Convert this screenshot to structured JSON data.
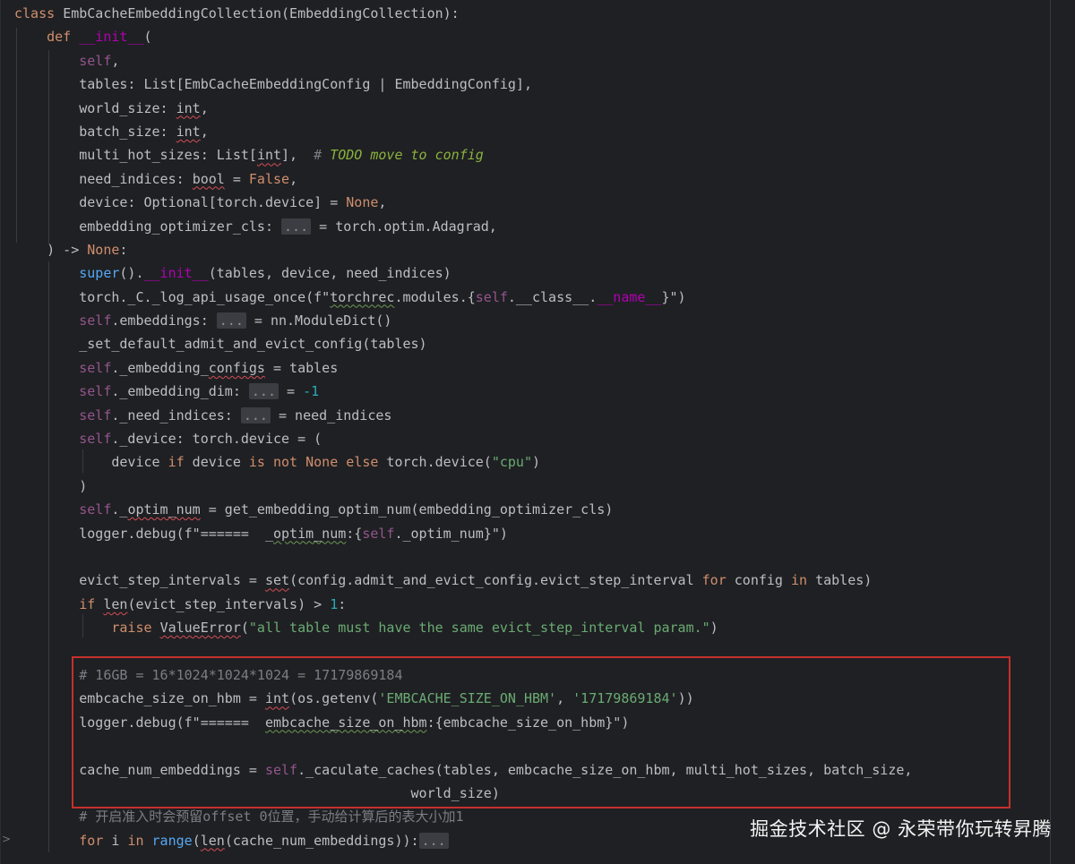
{
  "editor": {
    "lines": [
      [
        [
          "kw",
          "class "
        ],
        [
          "",
          "EmbCacheEmbeddingCollection(EmbeddingCollection):"
        ]
      ],
      [
        [
          "",
          "    "
        ],
        [
          "kw",
          "def "
        ],
        [
          "dunder",
          "__init__"
        ],
        [
          "",
          "("
        ]
      ],
      [
        [
          "",
          "        "
        ],
        [
          "self",
          "self"
        ],
        [
          "",
          ","
        ]
      ],
      [
        [
          "",
          "        tables: List[EmbCacheEmbeddingConfig | EmbeddingConfig],"
        ]
      ],
      [
        [
          "",
          "        world_size: "
        ],
        [
          "squig",
          "int"
        ],
        [
          "",
          ","
        ]
      ],
      [
        [
          "",
          "        batch_size: "
        ],
        [
          "squig",
          "int"
        ],
        [
          "",
          ","
        ]
      ],
      [
        [
          "",
          "        multi_hot_sizes: List["
        ],
        [
          "squig",
          "int"
        ],
        [
          "",
          "],  "
        ],
        [
          "cm",
          "# "
        ],
        [
          "todo",
          "TODO move to config"
        ]
      ],
      [
        [
          "",
          "        need_indices: "
        ],
        [
          "squig",
          "bool"
        ],
        [
          "",
          " = "
        ],
        [
          "kw",
          "False"
        ],
        [
          "",
          ","
        ]
      ],
      [
        [
          "",
          "        device: Optional[torch.device] = "
        ],
        [
          "kw",
          "None"
        ],
        [
          "",
          ","
        ]
      ],
      [
        [
          "",
          "        embedding_optimizer_cls: "
        ],
        [
          "fold",
          "..."
        ],
        [
          "",
          " = torch.optim.Adagrad,"
        ]
      ],
      [
        [
          "",
          "    ) -> "
        ],
        [
          "kw",
          "None"
        ],
        [
          "",
          ":"
        ]
      ],
      [
        [
          "",
          "        "
        ],
        [
          "fn",
          "super"
        ],
        [
          "",
          "()."
        ],
        [
          "dunder",
          "__init__"
        ],
        [
          "",
          "(tables, device, need_indices)"
        ]
      ],
      [
        [
          "",
          "        torch._C._log_api_usage_once(f\""
        ],
        [
          "squig-g",
          "torchrec"
        ],
        [
          "",
          ".modules.{"
        ],
        [
          "self",
          "self"
        ],
        [
          "",
          ".__class__."
        ],
        [
          "dunder",
          "__name__"
        ],
        [
          "",
          "}\")"
        ]
      ],
      [
        [
          "",
          "        "
        ],
        [
          "self",
          "self"
        ],
        [
          "",
          ".embeddings: "
        ],
        [
          "fold",
          "..."
        ],
        [
          "",
          " = nn.ModuleDict()"
        ]
      ],
      [
        [
          "",
          "        _set_default_admit_and_evict_config(tables)"
        ]
      ],
      [
        [
          "",
          "        "
        ],
        [
          "self",
          "self"
        ],
        [
          "",
          "._embedding_"
        ],
        [
          "squig",
          "configs"
        ],
        [
          "",
          " = tables"
        ]
      ],
      [
        [
          "",
          "        "
        ],
        [
          "self",
          "self"
        ],
        [
          "",
          "._embedding_dim: "
        ],
        [
          "fold",
          "..."
        ],
        [
          "",
          " = "
        ],
        [
          "num",
          "-1"
        ]
      ],
      [
        [
          "",
          "        "
        ],
        [
          "self",
          "self"
        ],
        [
          "",
          "._need_indices: "
        ],
        [
          "fold",
          "..."
        ],
        [
          "",
          " = need_indices"
        ]
      ],
      [
        [
          "",
          "        "
        ],
        [
          "self",
          "self"
        ],
        [
          "",
          "._device: torch.device = ("
        ]
      ],
      [
        [
          "",
          "            device "
        ],
        [
          "kw",
          "if"
        ],
        [
          "",
          " device "
        ],
        [
          "kw",
          "is not None else"
        ],
        [
          "",
          " torch.device("
        ],
        [
          "str",
          "\"cpu\""
        ],
        [
          "",
          ")"
        ]
      ],
      [
        [
          "",
          "        )"
        ]
      ],
      [
        [
          "",
          "        "
        ],
        [
          "self",
          "self"
        ],
        [
          "",
          "._"
        ],
        [
          "squig",
          "optim_num"
        ],
        [
          "",
          " = get_embedding_optim_num(embedding_optimizer_cls)"
        ]
      ],
      [
        [
          "",
          "        logger.debug(f\"======  _"
        ],
        [
          "squig-g",
          "optim_num"
        ],
        [
          "",
          ":{"
        ],
        [
          "self",
          "self"
        ],
        [
          "",
          "._optim_num}\")"
        ]
      ],
      [
        [
          "",
          ""
        ]
      ],
      [
        [
          "",
          "        evict_step_intervals = "
        ],
        [
          "squig",
          "set"
        ],
        [
          "",
          "(config.admit_and_evict_config.evict_step_interval "
        ],
        [
          "kw",
          "for"
        ],
        [
          "",
          " config "
        ],
        [
          "kw",
          "in"
        ],
        [
          "",
          " tables)"
        ]
      ],
      [
        [
          "",
          "        "
        ],
        [
          "kw",
          "if "
        ],
        [
          "squig",
          "len"
        ],
        [
          "",
          "(evict_step_intervals) > "
        ],
        [
          "num",
          "1"
        ],
        [
          "",
          ":"
        ]
      ],
      [
        [
          "",
          "            "
        ],
        [
          "kw",
          "raise "
        ],
        [
          "squig",
          "ValueError"
        ],
        [
          "",
          "("
        ],
        [
          "str",
          "\"all table must have the same evict_step_interval param.\""
        ],
        [
          "",
          ")"
        ]
      ],
      [
        [
          "",
          ""
        ]
      ],
      [
        [
          "",
          "        "
        ],
        [
          "cm",
          "# 16GB = 16*1024*1024*1024 = 17179869184"
        ]
      ],
      [
        [
          "",
          "        embcache_size_on_hbm = "
        ],
        [
          "squig",
          "int"
        ],
        [
          "",
          "(os.getenv("
        ],
        [
          "str",
          "'EMBCACHE_SIZE_ON_HBM'"
        ],
        [
          "",
          ", "
        ],
        [
          "str",
          "'17179869184'"
        ],
        [
          "",
          "))"
        ]
      ],
      [
        [
          "",
          "        logger.debug(f\"======  "
        ],
        [
          "squig-g",
          "embcache_size_on_hbm"
        ],
        [
          "",
          ":{embcache_size_on_hbm}\")"
        ]
      ],
      [
        [
          "",
          ""
        ]
      ],
      [
        [
          "",
          "        cache_num_embeddings = "
        ],
        [
          "self",
          "self"
        ],
        [
          "",
          "._caculate_caches(tables, embcache_size_on_hbm, multi_hot_sizes, batch_size,"
        ]
      ],
      [
        [
          "",
          "                                                 world_size)"
        ]
      ],
      [
        [
          "",
          "        "
        ],
        [
          "cm",
          "# 开启准入时会预留offset 0位置，手动给计算后的表大小加1"
        ]
      ],
      [
        [
          "",
          "        "
        ],
        [
          "kw",
          "for"
        ],
        [
          "",
          " i "
        ],
        [
          "kw",
          "in "
        ],
        [
          "fn",
          "range"
        ],
        [
          "",
          "("
        ],
        [
          "squig",
          "len"
        ],
        [
          "",
          "(cache_num_embeddings)):"
        ],
        [
          "fold",
          "..."
        ]
      ]
    ]
  },
  "watermark": "掘金技术社区 @ 永荣带你玩转昇腾",
  "gutter": {
    "fold_marker": ">"
  }
}
